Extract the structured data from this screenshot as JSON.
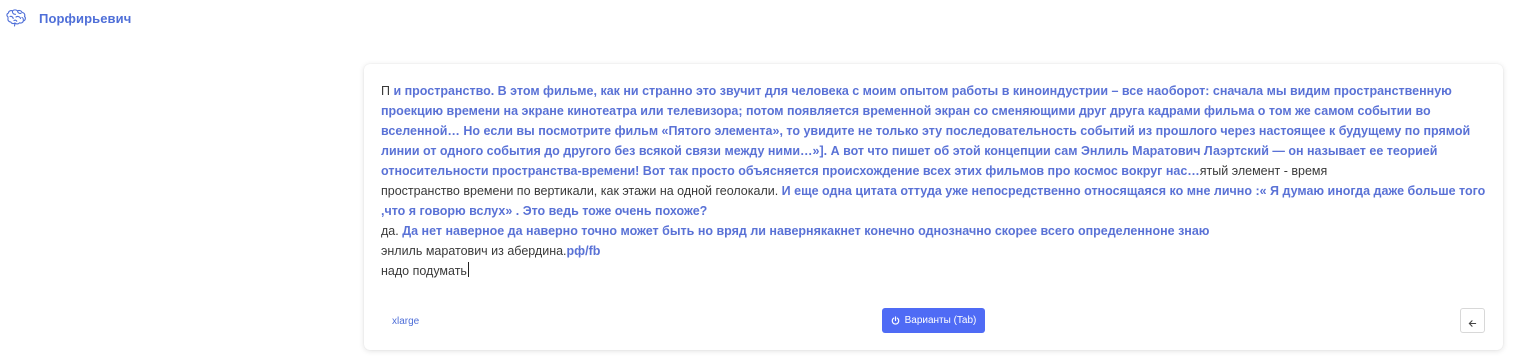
{
  "app": {
    "brand": "Порфирьевич"
  },
  "editor": {
    "paragraphs": [
      [
        {
          "t": "П ",
          "g": false
        },
        {
          "t": "и пространство. В этом фильме, как ни странно это звучит для человека с моим опытом работы в киноиндустрии – все наоборот: сначала мы видим пространственную проекцию времени на экране кинотеатра или телевизора; потом появляется временной экран со сменяющими друг друга кадрами фильма о том же самом событии во вселенной… Но если вы посмотрите фильм «Пятого элемента», то увидите не только эту последовательность событий из прошлого через настоящее к будущему по прямой линии от одного события до другого без всякой связи между ними…»]. А вот что пишет об этой концепции сам Энлиль Маратович Лаэртский — он называет ее теорией относительности пространства-времени! Вот так просто объясняется происхождение всех этих фильмов про космос вокруг нас…",
          "g": true
        },
        {
          "t": "ятый элемент - время",
          "g": false
        }
      ],
      [
        {
          "t": "пространство времени по вертикали, как этажи на одной геолокали. ",
          "g": false
        },
        {
          "t": "И еще одна цитата оттуда уже непосредственно относящаяся ко мне лично :« Я думаю иногда даже больше того ,что я говорю вслух» . Это ведь тоже очень похоже?",
          "g": true
        }
      ],
      [
        {
          "t": "да. ",
          "g": false
        },
        {
          "t": "Да нет наверное да наверно точно может быть но вряд ли навернякакнет конечно однозначно скорее всего определенноне знаю",
          "g": true
        }
      ],
      [
        {
          "t": "энлиль маратович из абердина.",
          "g": false
        },
        {
          "t": "рф/fb",
          "g": true
        }
      ],
      [
        {
          "t": "надо подумать",
          "g": false
        }
      ]
    ],
    "length_option": "xlarge",
    "variants_label": "Варианты (Tab)"
  },
  "icons": {
    "logo": "brain-icon",
    "variants": "power-icon",
    "back": "arrow-left-icon"
  },
  "colors": {
    "accent": "#4f6bf5",
    "generated_text": "#5a72d6",
    "brand_text": "#4f6fd8"
  }
}
